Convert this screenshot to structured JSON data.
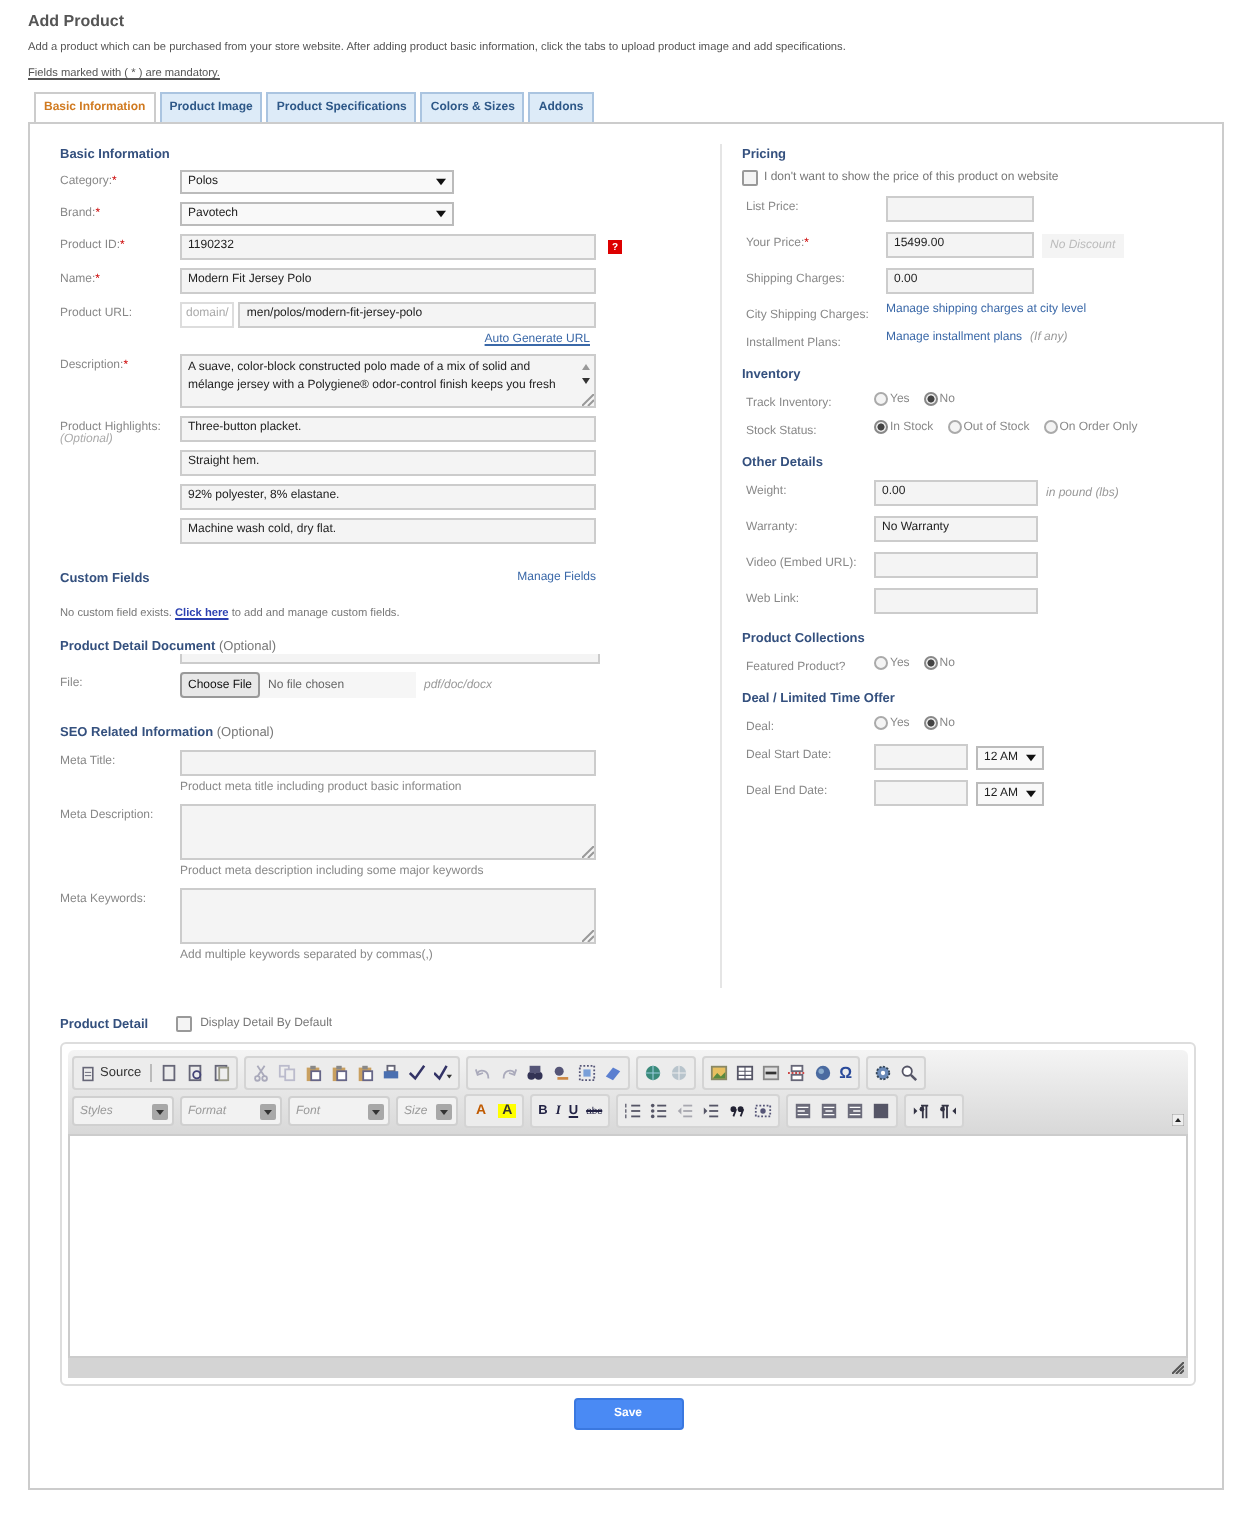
{
  "page": {
    "title": "Add Product",
    "intro": "Add a product which can be purchased from your store website. After adding product basic information, click the tabs to upload product image and add specifications.",
    "mandatory_note": "Fields marked with ( * ) are mandatory."
  },
  "tabs": [
    {
      "label": "Basic Information",
      "selected": true
    },
    {
      "label": "Product Image",
      "selected": false
    },
    {
      "label": "Product Specifications",
      "selected": false
    },
    {
      "label": "Colors & Sizes",
      "selected": false
    },
    {
      "label": "Addons",
      "selected": false
    }
  ],
  "basic_information": {
    "heading": "Basic Information",
    "fields": [
      {
        "kind": "select",
        "label": "Category:",
        "required_mark": "*",
        "value": "Polos"
      },
      {
        "kind": "select",
        "label": "Brand:",
        "required_mark": "*",
        "value": "Pavotech"
      },
      {
        "kind": "text",
        "label": "Product ID:",
        "required_mark": "*",
        "value": "1190232",
        "help": "?"
      },
      {
        "kind": "text",
        "label": "Name:",
        "required_mark": "*",
        "value": "Modern Fit Jersey Polo"
      },
      {
        "kind": "url",
        "label": "Product URL:",
        "prefix": "domain/",
        "value": "men/polos/modern-fit-jersey-polo",
        "link": "Auto Generate URL"
      },
      {
        "kind": "textarea",
        "label": "Description:",
        "required_mark": "*",
        "value": "A suave, color-block constructed polo made of a mix of solid and mélange jersey with a Polygiene® odor-control finish keeps you fresh"
      },
      {
        "kind": "list",
        "label": "Product Highlights:",
        "note": "(Optional)",
        "values": [
          "Three-button placket.",
          "Straight hem.",
          "92% polyester, 8% elastane.",
          "Machine wash cold, dry flat."
        ]
      }
    ]
  },
  "custom_fields": {
    "heading": "Custom Fields",
    "manage_link": "Manage Fields",
    "message_before": "No custom field exists.",
    "message_link": "Click here",
    "message_after": "to add and manage custom fields."
  },
  "document": {
    "heading": "Product Detail Document",
    "note": "(Optional)",
    "file_label": "File:",
    "choose_button": "Choose File",
    "file_status": "No file chosen",
    "file_types": "pdf/doc/docx"
  },
  "seo": {
    "heading": "SEO Related Information",
    "note": "(Optional)",
    "fields": [
      {
        "kind": "text",
        "label": "Meta Title:",
        "hint": "Product meta title including product basic information"
      },
      {
        "kind": "textarea",
        "label": "Meta Description:",
        "hint": "Product meta description including some major keywords"
      },
      {
        "kind": "textarea",
        "label": "Meta Keywords:",
        "hint": "Add multiple keywords separated by commas(,)"
      }
    ]
  },
  "pricing": {
    "heading": "Pricing",
    "checkbox": {
      "label": "I don't want to show the price of this product on website",
      "checked": false
    },
    "fields": [
      {
        "kind": "text",
        "label": "List Price:"
      },
      {
        "kind": "text",
        "label": "Your Price:",
        "required_mark": "*",
        "value": "15499.00",
        "badge": "No Discount"
      },
      {
        "kind": "text",
        "label": "Shipping Charges:",
        "value": "0.00"
      },
      {
        "kind": "link",
        "label": "City Shipping Charges:",
        "link": "Manage shipping charges at city level"
      },
      {
        "kind": "link",
        "label": "Installment Plans:",
        "link": "Manage installment plans",
        "note": "(If any)"
      }
    ]
  },
  "inventory": {
    "heading": "Inventory",
    "fields": [
      {
        "kind": "radio",
        "label": "Track Inventory:",
        "options": [
          {
            "label": "Yes",
            "selected": false
          },
          {
            "label": "No",
            "selected": true
          }
        ]
      },
      {
        "kind": "radio",
        "label": "Stock Status:",
        "options": [
          {
            "label": "In Stock",
            "selected": true
          },
          {
            "label": "Out of Stock",
            "selected": false
          },
          {
            "label": "On Order Only",
            "selected": false
          }
        ]
      }
    ]
  },
  "other_details": {
    "heading": "Other Details",
    "fields": [
      {
        "kind": "text",
        "label": "Weight:",
        "value": "0.00",
        "suffix": "in pound (lbs)"
      },
      {
        "kind": "text",
        "label": "Warranty:",
        "value": "No Warranty"
      },
      {
        "kind": "text",
        "label": "Video (Embed URL):"
      },
      {
        "kind": "text",
        "label": "Web Link:"
      }
    ]
  },
  "collections": {
    "heading": "Product Collections",
    "fields": [
      {
        "kind": "radio",
        "label": "Featured Product?",
        "options": [
          {
            "label": "Yes",
            "selected": false
          },
          {
            "label": "No",
            "selected": true
          }
        ]
      }
    ]
  },
  "deal": {
    "heading": "Deal / Limited Time Offer",
    "fields": [
      {
        "kind": "radio",
        "label": "Deal:",
        "options": [
          {
            "label": "Yes",
            "selected": false
          },
          {
            "label": "No",
            "selected": true
          }
        ]
      },
      {
        "kind": "date",
        "label": "Deal Start Date:",
        "time": "12 AM"
      },
      {
        "kind": "date",
        "label": "Deal End Date:",
        "time": "12 AM"
      }
    ]
  },
  "product_detail": {
    "heading": "Product Detail",
    "checkbox": {
      "label": "Display Detail By Default",
      "checked": false
    }
  },
  "editor": {
    "source_label": "Source",
    "special_char": "Ω",
    "combos": [
      "Styles",
      "Format",
      "Font",
      "Size"
    ],
    "color_buttons": [
      "A",
      "A"
    ],
    "style_buttons": [
      "B",
      "I",
      "U",
      "abc"
    ]
  },
  "save_button": "Save"
}
